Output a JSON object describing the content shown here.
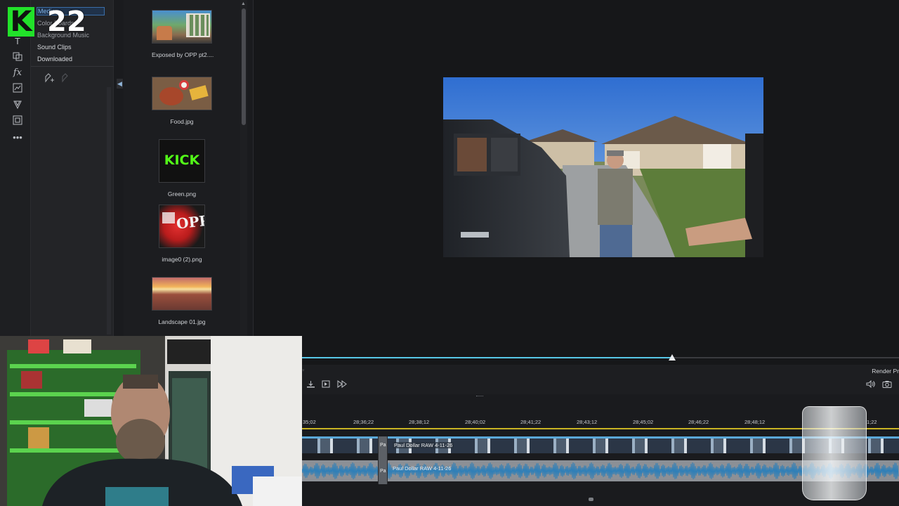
{
  "overlay": {
    "logo_letter": "K",
    "counter": "22"
  },
  "sidebar": {
    "categories": [
      {
        "label": "Media"
      },
      {
        "label": "Color Boards"
      },
      {
        "label": "Background Music"
      },
      {
        "label": "Sound Clips"
      },
      {
        "label": "Downloaded"
      }
    ]
  },
  "media": {
    "items": [
      {
        "name": "Exposed by OPP pt2...."
      },
      {
        "name": "Food.jpg"
      },
      {
        "name": "Green.png",
        "thumb_text": "KICK"
      },
      {
        "name": "image0 (2).png",
        "thumb_text": "OPP"
      },
      {
        "name": "Landscape 01.jpg"
      }
    ]
  },
  "player": {
    "progress": 0.62
  },
  "toolbar": {
    "render_label": "Render Pr"
  },
  "timeline": {
    "ticks": [
      "35;02",
      "28;36;22",
      "28;38;12",
      "28;40;02",
      "28;41;22",
      "28;43;12",
      "28;45;02",
      "28;46;22",
      "28;48;12",
      "1;22"
    ],
    "video_clip_label": "Paul Dollar RAW 4-11-26",
    "audio_clip_label": "Paul Dollar RAW 4-11-26",
    "split_label": "Pa"
  },
  "colors": {
    "accent": "#57c7e6",
    "ruler": "#c9b324",
    "logo": "#22e12a"
  }
}
